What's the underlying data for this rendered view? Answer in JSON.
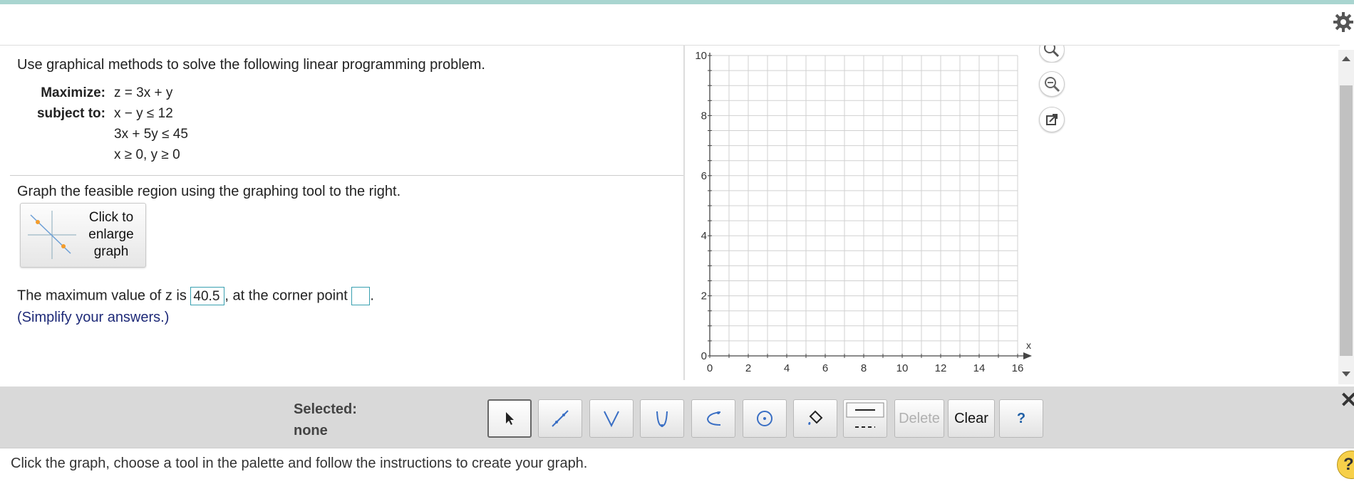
{
  "problem": {
    "instruction": "Use graphical methods to solve the following linear programming problem.",
    "maximize_label": "Maximize:",
    "objective": "z = 3x + y",
    "subject_label": "subject to:",
    "constraints": [
      "x − y ≤ 12",
      "3x + 5y ≤ 45",
      "x ≥ 0, y ≥ 0"
    ],
    "graph_instruction": "Graph the feasible region using the graphing tool to the right.",
    "enlarge_lines": [
      "Click to",
      "enlarge",
      "graph"
    ],
    "answer_prefix": "The maximum value of z is",
    "answer_value": "40.5",
    "answer_middle": ", at the corner point",
    "answer_point": "",
    "answer_suffix": ".",
    "hint": "(Simplify your answers.)"
  },
  "graph": {
    "x_ticks": [
      "0",
      "2",
      "4",
      "6",
      "8",
      "10",
      "12",
      "14",
      "16"
    ],
    "y_ticks": [
      "0",
      "2",
      "4",
      "6",
      "8",
      "10"
    ],
    "x_axis_label": "x",
    "x_range": [
      0,
      16
    ],
    "y_range": [
      0,
      10
    ],
    "grid": true
  },
  "toolbar": {
    "selected_label": "Selected:",
    "selected_value": "none",
    "delete_label": "Delete",
    "clear_label": "Clear",
    "help_label": "?",
    "tools": [
      "pointer-icon",
      "line-icon",
      "absolute-value-icon",
      "parabola-icon",
      "exponential-icon",
      "circle-icon",
      "fill-icon",
      "line-style-icon"
    ]
  },
  "status": {
    "text": "Click the graph, choose a tool in the palette and follow the instructions to create your graph.",
    "help": "?"
  },
  "colors": {
    "accent": "#39a0b0",
    "hint": "#1e2a78",
    "toolbar_bg": "#d9d9d9",
    "top_bar": "#a9d5d0"
  }
}
